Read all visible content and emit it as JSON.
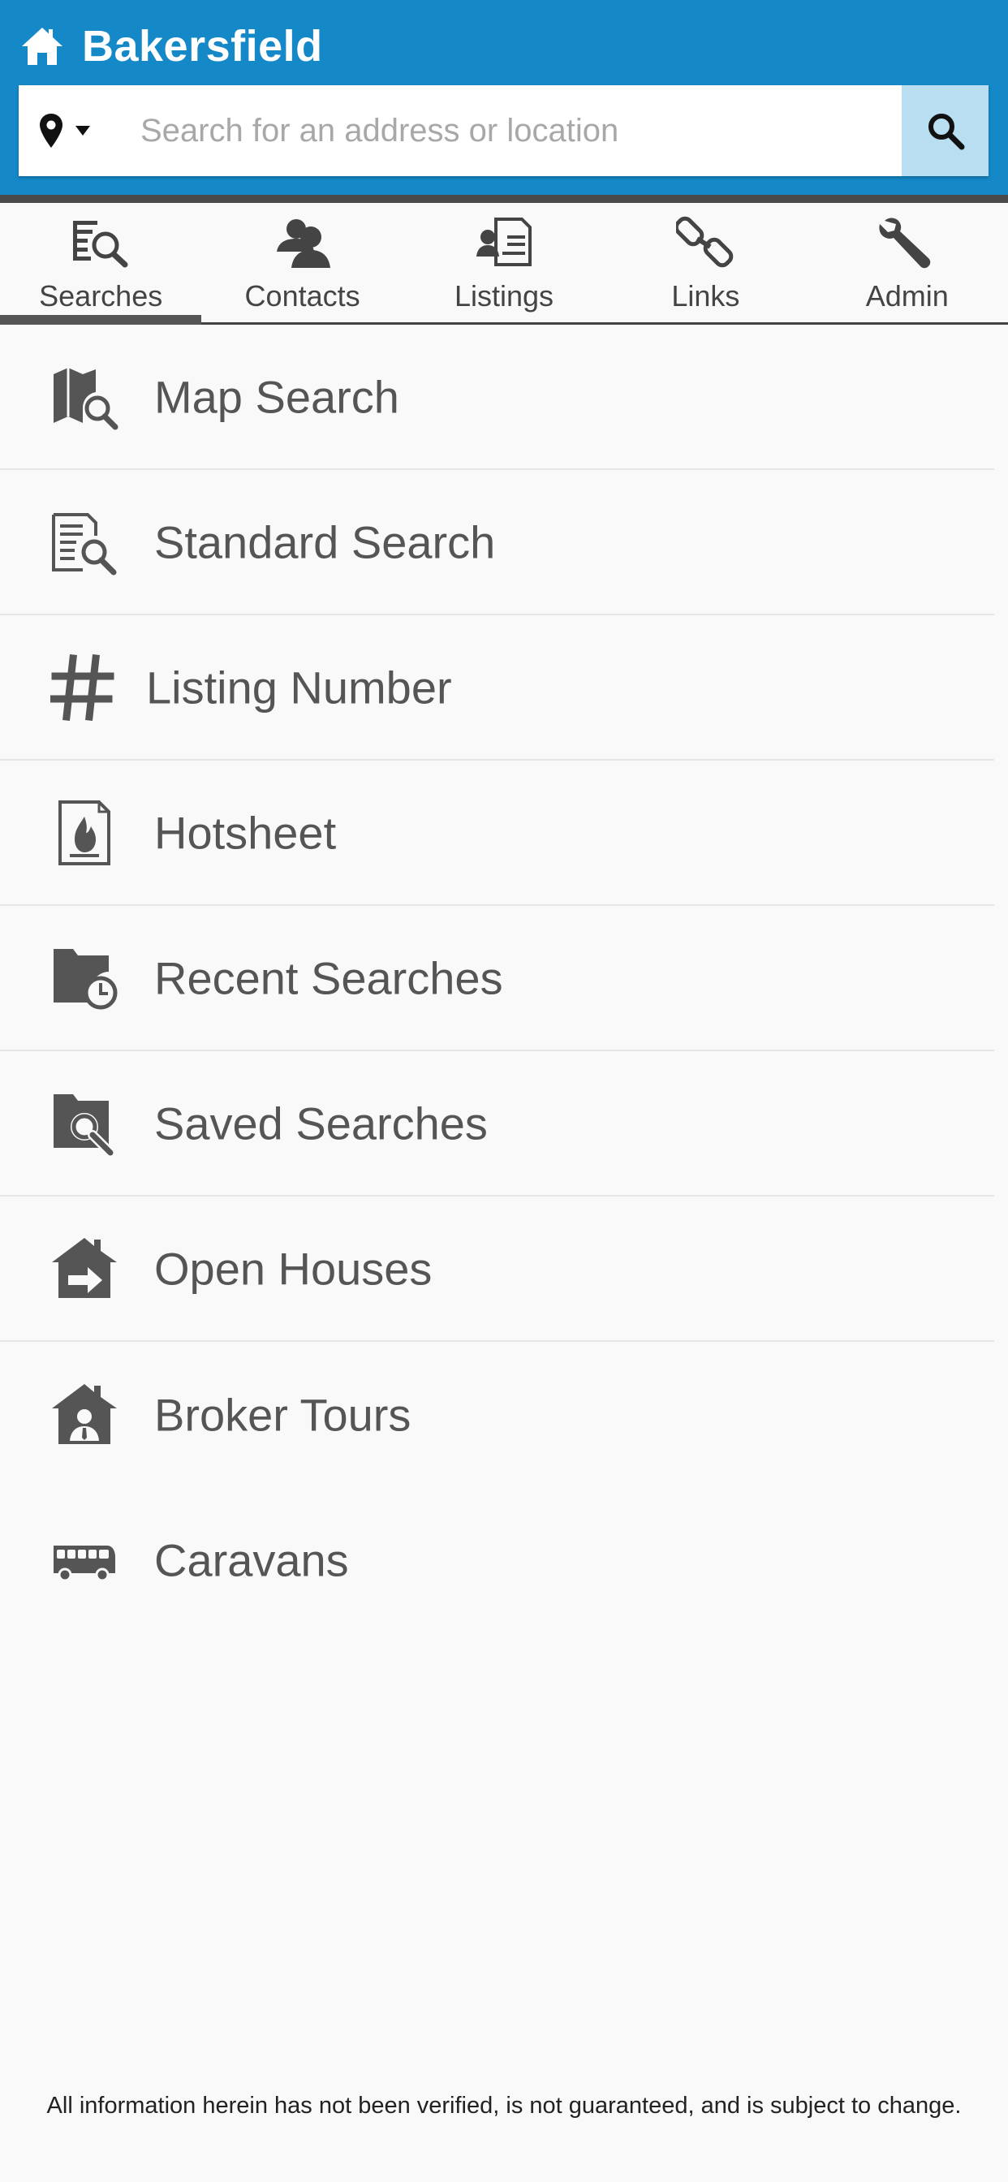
{
  "header": {
    "title": "Bakersfield",
    "search_placeholder": "Search for an address or location",
    "background_color": "#1588c8",
    "search_button_color": "#b9ddf1"
  },
  "tabs": [
    {
      "label": "Searches",
      "icon": "searches-icon",
      "active": true
    },
    {
      "label": "Contacts",
      "icon": "contacts-icon",
      "active": false
    },
    {
      "label": "Listings",
      "icon": "listings-icon",
      "active": false
    },
    {
      "label": "Links",
      "icon": "links-icon",
      "active": false
    },
    {
      "label": "Admin",
      "icon": "wrench-icon",
      "active": false
    }
  ],
  "menu": [
    {
      "label": "Map Search",
      "icon": "map-search-icon"
    },
    {
      "label": "Standard Search",
      "icon": "standard-search-icon"
    },
    {
      "label": "Listing Number",
      "icon": "hash-icon"
    },
    {
      "label": "Hotsheet",
      "icon": "hotsheet-icon"
    },
    {
      "label": "Recent Searches",
      "icon": "recent-searches-icon"
    },
    {
      "label": "Saved Searches",
      "icon": "saved-searches-icon"
    },
    {
      "label": "Open Houses",
      "icon": "open-houses-icon"
    },
    {
      "label": "Broker Tours",
      "icon": "broker-tours-icon"
    },
    {
      "label": "Caravans",
      "icon": "caravan-bus-icon"
    }
  ],
  "footer": {
    "disclaimer": "All information herein has not been verified, is not guaranteed, and is subject to change."
  }
}
